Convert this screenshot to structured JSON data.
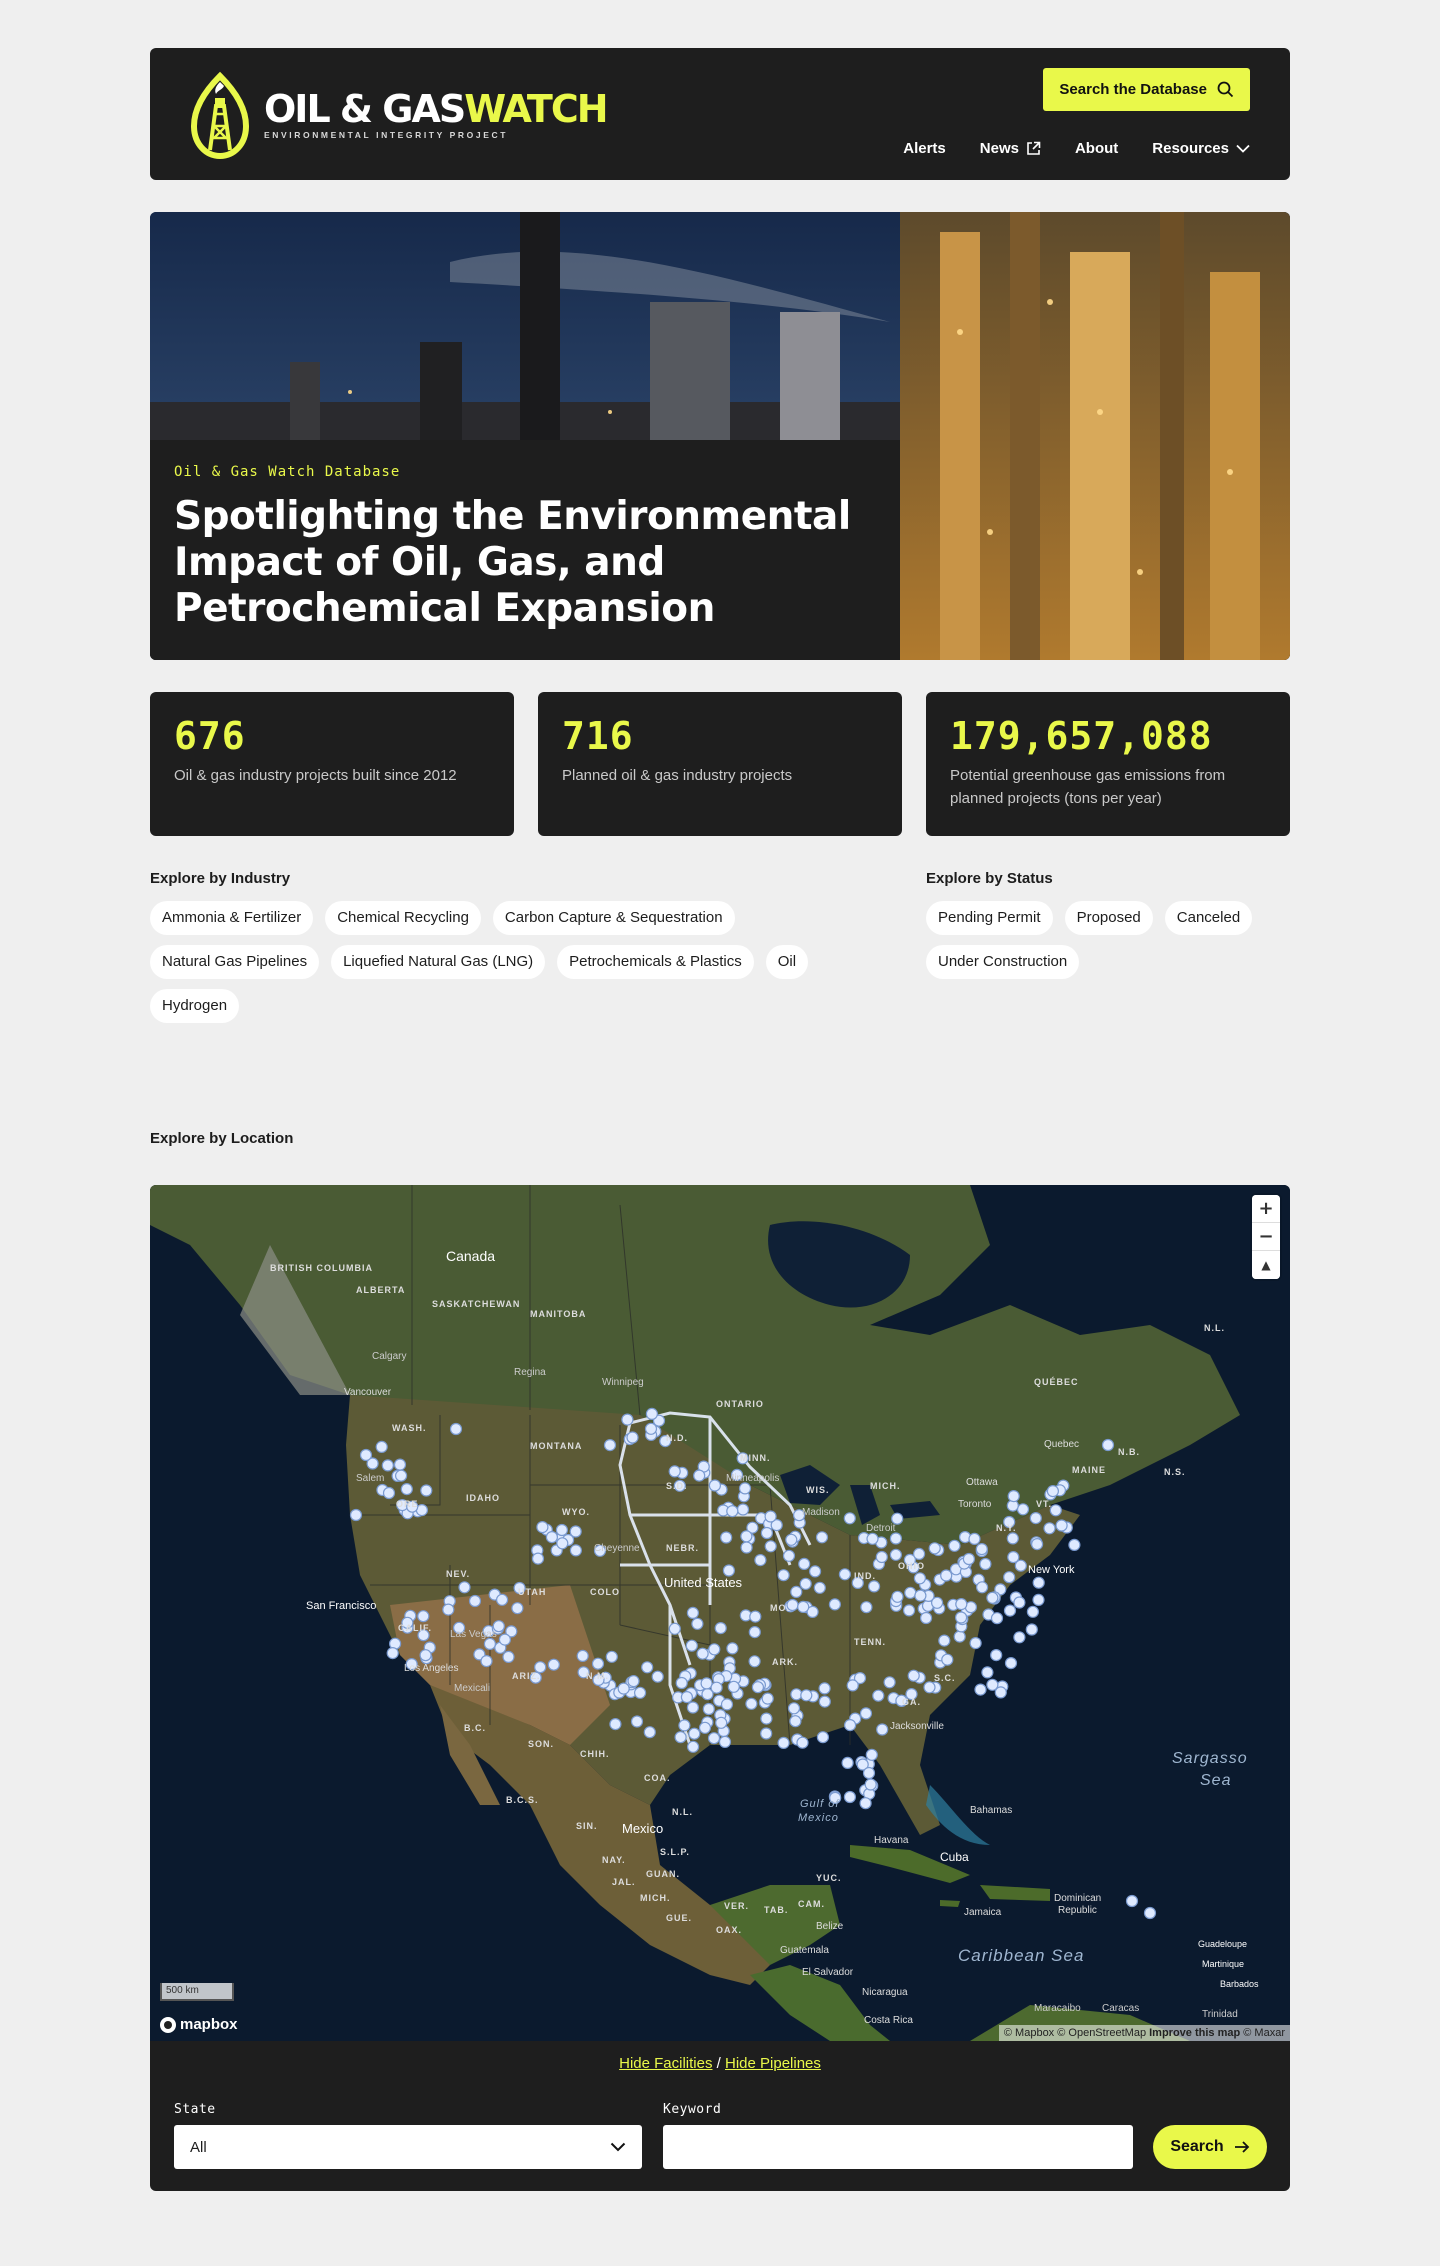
{
  "header": {
    "logo_title_white": "OIL & GAS",
    "logo_title_yellow": "WATCH",
    "logo_subtitle": "ENVIRONMENTAL INTEGRITY PROJECT",
    "search_button": "Search the Database",
    "nav": {
      "alerts": "Alerts",
      "news": "News",
      "about": "About",
      "resources": "Resources"
    },
    "icons": [
      "search-icon",
      "external-link-icon",
      "chevron-down-icon"
    ]
  },
  "hero": {
    "eyebrow": "Oil & Gas Watch Database",
    "title": "Spotlighting the Environmental Impact of Oil, Gas, and Petrochemical Expansion"
  },
  "stats": [
    {
      "value": "676",
      "label": "Oil & gas industry projects built since 2012"
    },
    {
      "value": "716",
      "label": "Planned oil & gas industry projects"
    },
    {
      "value": "179,657,088",
      "label": "Potential greenhouse gas emissions from planned projects (tons per year)"
    }
  ],
  "explore_industry": {
    "title": "Explore by Industry",
    "chips": [
      "Ammonia & Fertilizer",
      "Chemical Recycling",
      "Carbon Capture & Sequestration",
      "Natural Gas Pipelines",
      "Liquefied Natural Gas (LNG)",
      "Petrochemicals & Plastics",
      "Oil",
      "Hydrogen"
    ]
  },
  "explore_status": {
    "title": "Explore by Status",
    "chips": [
      "Pending Permit",
      "Proposed",
      "Canceled",
      "Under Construction"
    ]
  },
  "explore_location": {
    "title": "Explore by Location"
  },
  "map": {
    "labels": {
      "canada": "Canada",
      "bc": "BRITISH COLUMBIA",
      "alberta": "ALBERTA",
      "sask": "SASKATCHEWAN",
      "manitoba": "MANITOBA",
      "ontario": "ONTARIO",
      "quebec": "QUÉBEC",
      "nl": "N.L.",
      "nb": "N.B.",
      "ns": "N.S.",
      "maine": "MAINE",
      "calgary": "Calgary",
      "regina": "Regina",
      "winnipeg": "Winnipeg",
      "vancouver": "Vancouver",
      "quebec_city": "Quebec",
      "ottawa": "Ottawa",
      "toronto": "Toronto",
      "new_york": "New York",
      "us": "United States",
      "san_francisco": "San Francisco",
      "los_angeles": "Los Angeles",
      "las_vegas": "Las Vegas",
      "mexico": "Mexico",
      "gulf": "Gulf of",
      "gulf2": "Mexico",
      "havana": "Havana",
      "cuba": "Cuba",
      "bahamas": "Bahamas",
      "sargasso": "Sargasso",
      "sargasso2": "Sea",
      "caribbean": "Caribbean Sea",
      "jamaica": "Jamaica",
      "dominican": "Dominican",
      "dominican2": "Republic",
      "guatemala": "Guatemala",
      "el_salvador": "El Salvador",
      "nicaragua": "Nicaragua",
      "costa_rica": "Costa Rica",
      "belize": "Belize",
      "guadeloupe": "Guadeloupe",
      "martinique": "Martinique",
      "barbados": "Barbados",
      "maracaibo": "Maracaibo",
      "caracas": "Caracas",
      "trinidad": "Trinidad",
      "wash": "WASH.",
      "ore": "ORE.",
      "calif": "CALIF.",
      "idaho": "IDAHO",
      "mont": "MONTANA",
      "wyo": "WYO.",
      "colo": "COLO",
      "utah": "UTAH",
      "ariz": "ARIZ.",
      "nm": "N.M.",
      "nev": "NEV.",
      "nd": "N.D.",
      "sd": "S.D.",
      "nebr": "NEBR.",
      "minn": "MINN.",
      "wis": "WIS.",
      "mich": "MICH.",
      "ny": "N.Y.",
      "vt": "VT.",
      "ohio": "OHIO",
      "ind": "IND.",
      "mo": "MO.",
      "ark": "ARK.",
      "tenn": "TENN.",
      "sc": "S.C.",
      "ga": "GA.",
      "son": "SON.",
      "chih": "CHIH.",
      "coa": "COA.",
      "bcs": "B.C.S.",
      "bc_mx": "B.C.",
      "sin": "SIN.",
      "nay": "NAY.",
      "jal": "JAL.",
      "mich_mx": "MICH.",
      "gue": "GUE.",
      "oax": "OAX.",
      "ver": "VER.",
      "tab": "TAB.",
      "cam": "CAM.",
      "yuc": "YUC.",
      "guan": "GUAN.",
      "slp": "S.L.P.",
      "nl_mx": "N.L.",
      "jacksonville": "Jacksonville",
      "detroit": "Detroit",
      "minneapolis": "Minneapolis",
      "cheyenne": "Cheyenne",
      "salem": "Salem",
      "madison": "Madison",
      "mexicali": "Mexicali"
    },
    "zoom_in": "+",
    "zoom_out": "−",
    "compass": "▲",
    "scale": "500 km",
    "mapbox": "mapbox",
    "attribution": "© Mapbox © OpenStreetMap",
    "improve": "Improve this map",
    "maxar": "© Maxar"
  },
  "filter": {
    "hide_facilities": "Hide Facilities",
    "separator": "/",
    "hide_pipelines": "Hide Pipelines",
    "state_label": "State",
    "state_value": "All",
    "keyword_label": "Keyword",
    "keyword_value": "",
    "search_button": "Search"
  },
  "colors": {
    "accent": "#e9f84a",
    "dark": "#1e1e1e",
    "background": "#efefef",
    "facility_marker": "#dfeaff"
  }
}
